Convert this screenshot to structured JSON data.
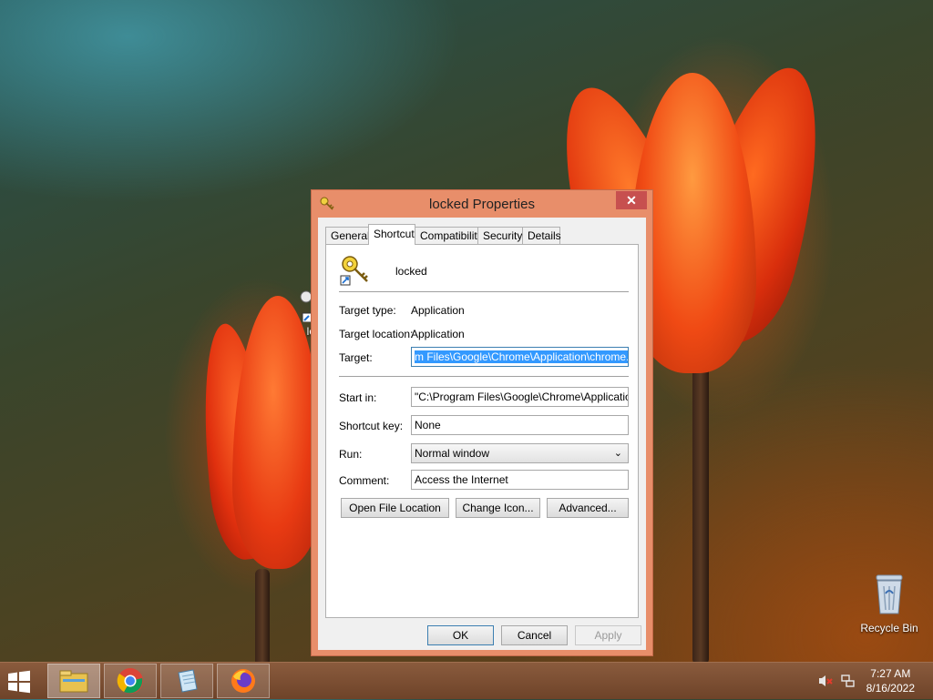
{
  "dialog": {
    "title": "locked Properties",
    "close_glyph": "✕",
    "tabs": [
      {
        "label": "General"
      },
      {
        "label": "Shortcut"
      },
      {
        "label": "Compatibility"
      },
      {
        "label": "Security"
      },
      {
        "label": "Details"
      }
    ],
    "active_tab": "Shortcut",
    "shortcut_name": "locked",
    "target_type_label": "Target type:",
    "target_type_value": "Application",
    "target_location_label": "Target location:",
    "target_location_value": "Application",
    "target_label": "Target:",
    "target_value": "m Files\\Google\\Chrome\\Application\\chrome.exe\"",
    "start_in_label": "Start in:",
    "start_in_value": "\"C:\\Program Files\\Google\\Chrome\\Application\"",
    "shortcut_key_label": "Shortcut key:",
    "shortcut_key_value": "None",
    "run_label": "Run:",
    "run_value": "Normal window",
    "comment_label": "Comment:",
    "comment_value": "Access the Internet",
    "open_file_location_label": "Open File Location",
    "change_icon_label": "Change Icon...",
    "advanced_label": "Advanced...",
    "ok_label": "OK",
    "cancel_label": "Cancel",
    "apply_label": "Apply"
  },
  "desktop": {
    "partial_icon_label": "lo",
    "recycle_bin_label": "Recycle Bin"
  },
  "taskbar": {
    "apps": [
      {
        "name": "file-explorer-icon"
      },
      {
        "name": "chrome-icon"
      },
      {
        "name": "notepad-icon"
      },
      {
        "name": "firefox-icon"
      }
    ],
    "clock_time": "7:27 AM",
    "clock_date": "8/16/2022"
  },
  "colors": {
    "title_bar": "#e88e6a",
    "close_button": "#c7504f",
    "selection": "#3399ff",
    "taskbar": "#7a4c30"
  }
}
